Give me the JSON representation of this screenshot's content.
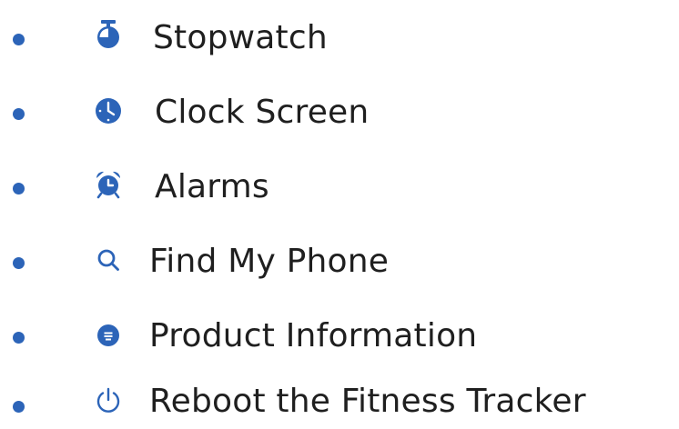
{
  "accent_color": "#2c64b8",
  "menu": {
    "items": [
      {
        "label": "Stopwatch",
        "icon": "stopwatch-icon"
      },
      {
        "label": "Clock Screen",
        "icon": "clock-icon"
      },
      {
        "label": "Alarms",
        "icon": "alarm-clock-icon"
      },
      {
        "label": "Find My Phone",
        "icon": "search-icon"
      },
      {
        "label": "Product Information",
        "icon": "info-icon"
      },
      {
        "label": "Reboot the Fitness Tracker",
        "icon": "power-icon"
      }
    ]
  }
}
